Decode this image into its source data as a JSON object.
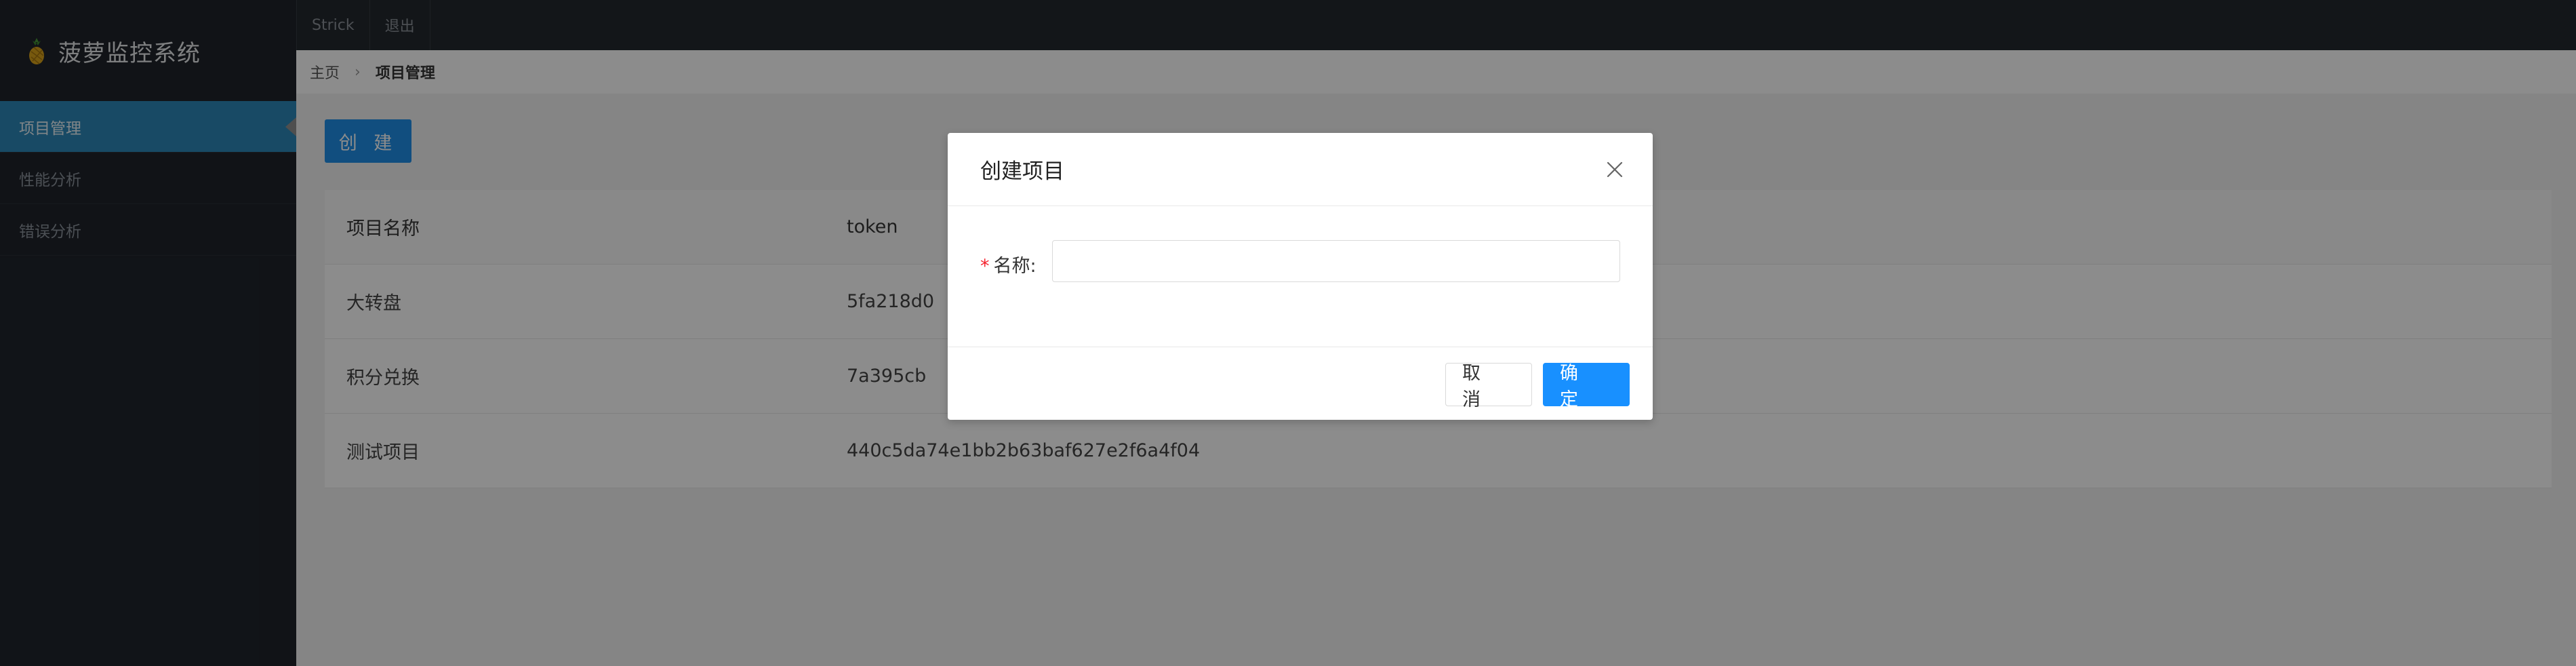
{
  "app": {
    "title": "菠萝监控系统"
  },
  "sidebar": {
    "items": [
      {
        "label": "项目管理",
        "active": true
      },
      {
        "label": "性能分析",
        "active": false
      },
      {
        "label": "错误分析",
        "active": false
      }
    ]
  },
  "topbar": {
    "user": "Strick",
    "logout": "退出"
  },
  "breadcrumb": {
    "home": "主页",
    "current": "项目管理"
  },
  "main": {
    "create_label": "创 建",
    "table": {
      "headers": [
        "项目名称",
        "token"
      ],
      "rows": [
        {
          "name": "大转盘",
          "token": "5fa218d0"
        },
        {
          "name": "积分兑换",
          "token": "7a395cb"
        },
        {
          "name": "测试项目",
          "token": "440c5da74e1bb2b63baf627e2f6a4f04"
        }
      ]
    }
  },
  "modal": {
    "title": "创建项目",
    "field_label": "名称:",
    "field_required_mark": "*",
    "field_value": "",
    "cancel_label": "取 消",
    "ok_label": "确 定"
  },
  "colors": {
    "sidebar_bg": "#1f242b",
    "active_item": "#2c88b8",
    "primary": "#1890ff"
  }
}
